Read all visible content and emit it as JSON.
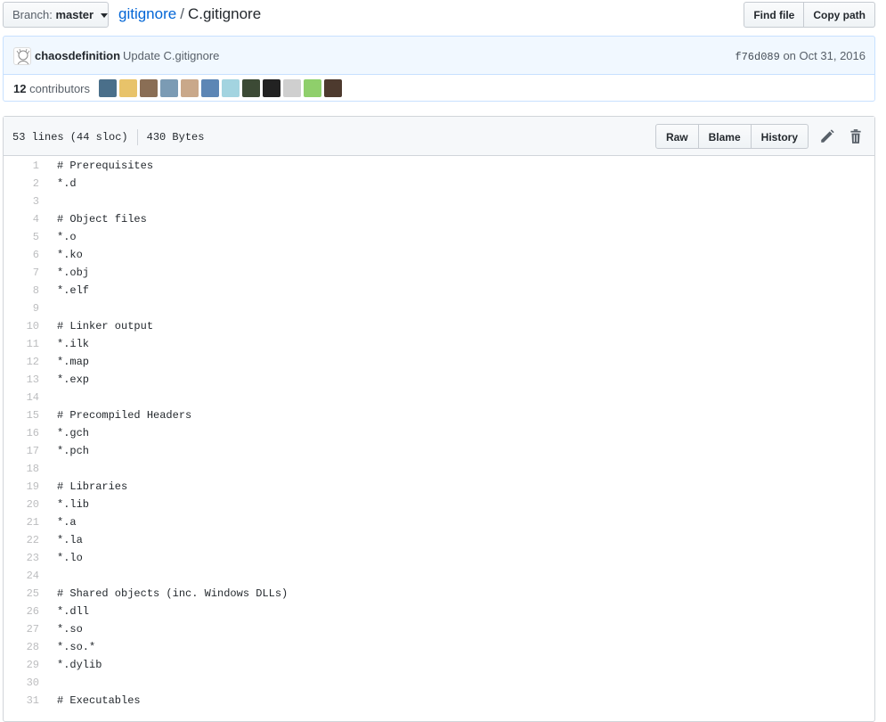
{
  "branch": {
    "label": "Branch:",
    "value": "master"
  },
  "breadcrumb": {
    "repo": "gitignore",
    "separator": "/",
    "file": "C.gitignore"
  },
  "header_buttons": {
    "find_file": "Find file",
    "copy_path": "Copy path"
  },
  "commit": {
    "author": "chaosdefinition",
    "message": "Update C.gitignore",
    "sha": "f76d089",
    "date_prefix": "on",
    "date": "Oct 31, 2016"
  },
  "contributors": {
    "count": "12",
    "label": "contributors",
    "avatar_colors": [
      "#4a6f8a",
      "#e8c36a",
      "#8a6e55",
      "#7b9bb4",
      "#c9a88a",
      "#5d86b5",
      "#a3d4e0",
      "#3c4a35",
      "#222222",
      "#cfcfcf",
      "#8fcf6b",
      "#4d3a2e"
    ]
  },
  "file": {
    "lines_info": "53 lines (44 sloc)",
    "size": "430 Bytes",
    "actions": {
      "raw": "Raw",
      "blame": "Blame",
      "history": "History"
    },
    "icons": {
      "edit": "pencil-icon",
      "delete": "trash-icon"
    }
  },
  "code_lines": [
    {
      "n": "1",
      "t": "# Prerequisites"
    },
    {
      "n": "2",
      "t": "*.d"
    },
    {
      "n": "3",
      "t": ""
    },
    {
      "n": "4",
      "t": "# Object files"
    },
    {
      "n": "5",
      "t": "*.o"
    },
    {
      "n": "6",
      "t": "*.ko"
    },
    {
      "n": "7",
      "t": "*.obj"
    },
    {
      "n": "8",
      "t": "*.elf"
    },
    {
      "n": "9",
      "t": ""
    },
    {
      "n": "10",
      "t": "# Linker output"
    },
    {
      "n": "11",
      "t": "*.ilk"
    },
    {
      "n": "12",
      "t": "*.map"
    },
    {
      "n": "13",
      "t": "*.exp"
    },
    {
      "n": "14",
      "t": ""
    },
    {
      "n": "15",
      "t": "# Precompiled Headers"
    },
    {
      "n": "16",
      "t": "*.gch"
    },
    {
      "n": "17",
      "t": "*.pch"
    },
    {
      "n": "18",
      "t": ""
    },
    {
      "n": "19",
      "t": "# Libraries"
    },
    {
      "n": "20",
      "t": "*.lib"
    },
    {
      "n": "21",
      "t": "*.a"
    },
    {
      "n": "22",
      "t": "*.la"
    },
    {
      "n": "23",
      "t": "*.lo"
    },
    {
      "n": "24",
      "t": ""
    },
    {
      "n": "25",
      "t": "# Shared objects (inc. Windows DLLs)"
    },
    {
      "n": "26",
      "t": "*.dll"
    },
    {
      "n": "27",
      "t": "*.so"
    },
    {
      "n": "28",
      "t": "*.so.*"
    },
    {
      "n": "29",
      "t": "*.dylib"
    },
    {
      "n": "30",
      "t": ""
    },
    {
      "n": "31",
      "t": "# Executables"
    }
  ]
}
